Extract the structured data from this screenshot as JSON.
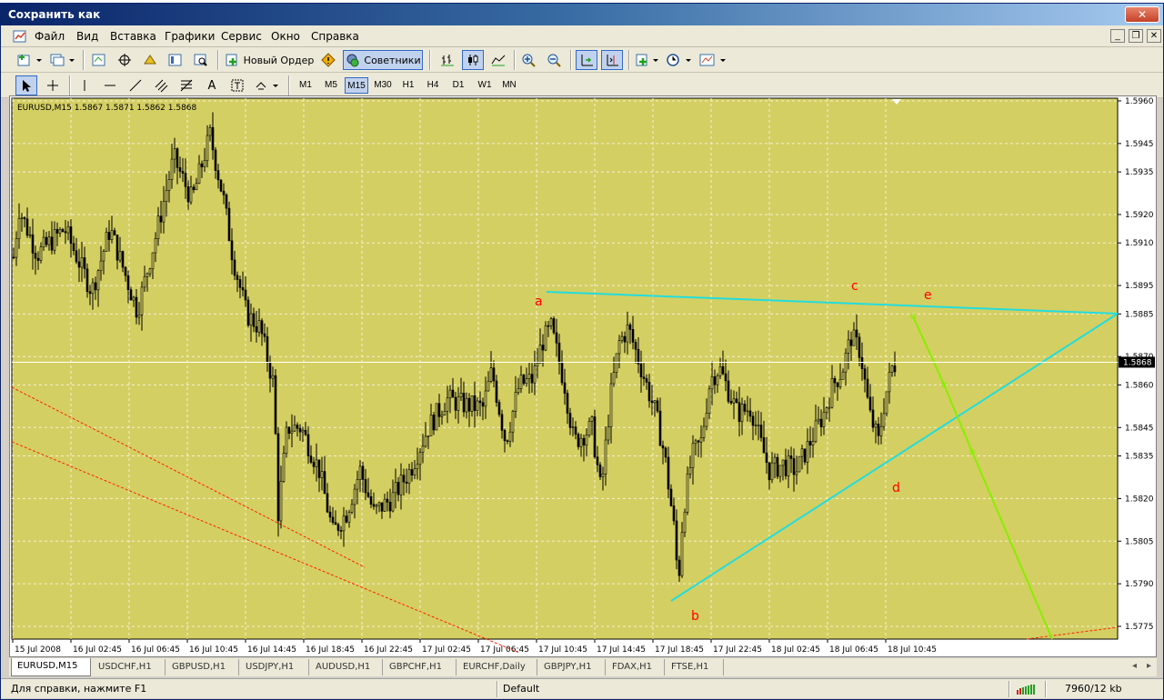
{
  "window": {
    "title": "Сохранить как"
  },
  "menu": {
    "items": [
      "Файл",
      "Вид",
      "Вставка",
      "Графики",
      "Сервис",
      "Окно",
      "Справка"
    ]
  },
  "toolbar": {
    "new_order_label": "Новый Ордер",
    "experts_label": "Советники",
    "timeframes": [
      "M1",
      "M5",
      "M15",
      "M30",
      "H1",
      "H4",
      "D1",
      "W1",
      "MN"
    ],
    "active_timeframe": "M15"
  },
  "chart": {
    "header": "EURUSD,M15  1.5867 1.5871 1.5862 1.5868",
    "background": "#d4cf62",
    "current_price": "1.5868",
    "price_ticks": [
      "1.5960",
      "1.5945",
      "1.5935",
      "1.5920",
      "1.5910",
      "1.5895",
      "1.5885",
      "1.5870",
      "1.5860",
      "1.5845",
      "1.5835",
      "1.5820",
      "1.5805",
      "1.5790",
      "1.5775"
    ],
    "time_ticks": [
      "15 Jul 2008",
      "16 Jul 02:45",
      "16 Jul 06:45",
      "16 Jul 10:45",
      "16 Jul 14:45",
      "16 Jul 18:45",
      "16 Jul 22:45",
      "17 Jul 02:45",
      "17 Jul 06:45",
      "17 Jul 10:45",
      "17 Jul 14:45",
      "17 Jul 18:45",
      "17 Jul 22:45",
      "18 Jul 02:45",
      "18 Jul 06:45",
      "18 Jul 10:45"
    ],
    "wave_labels": [
      "a",
      "b",
      "c",
      "d",
      "e"
    ],
    "colors": {
      "trendline": "#22dddd",
      "projection": "#88ee00",
      "fib_lines": "#ff2200",
      "labels": "#ff0000",
      "candles": "#000000",
      "grid": "#f2f0d8"
    }
  },
  "tabs": {
    "items": [
      "EURUSD,M15",
      "USDCHF,H1",
      "GBPUSD,H1",
      "USDJPY,H1",
      "AUDUSD,H1",
      "GBPCHF,H1",
      "EURCHF,Daily",
      "GBPJPY,H1",
      "FDAX,H1",
      "FTSE,H1"
    ],
    "active": "EURUSD,M15"
  },
  "status": {
    "help": "Для справки, нажмите F1",
    "profile": "Default",
    "traffic": "7960/12 kb"
  }
}
